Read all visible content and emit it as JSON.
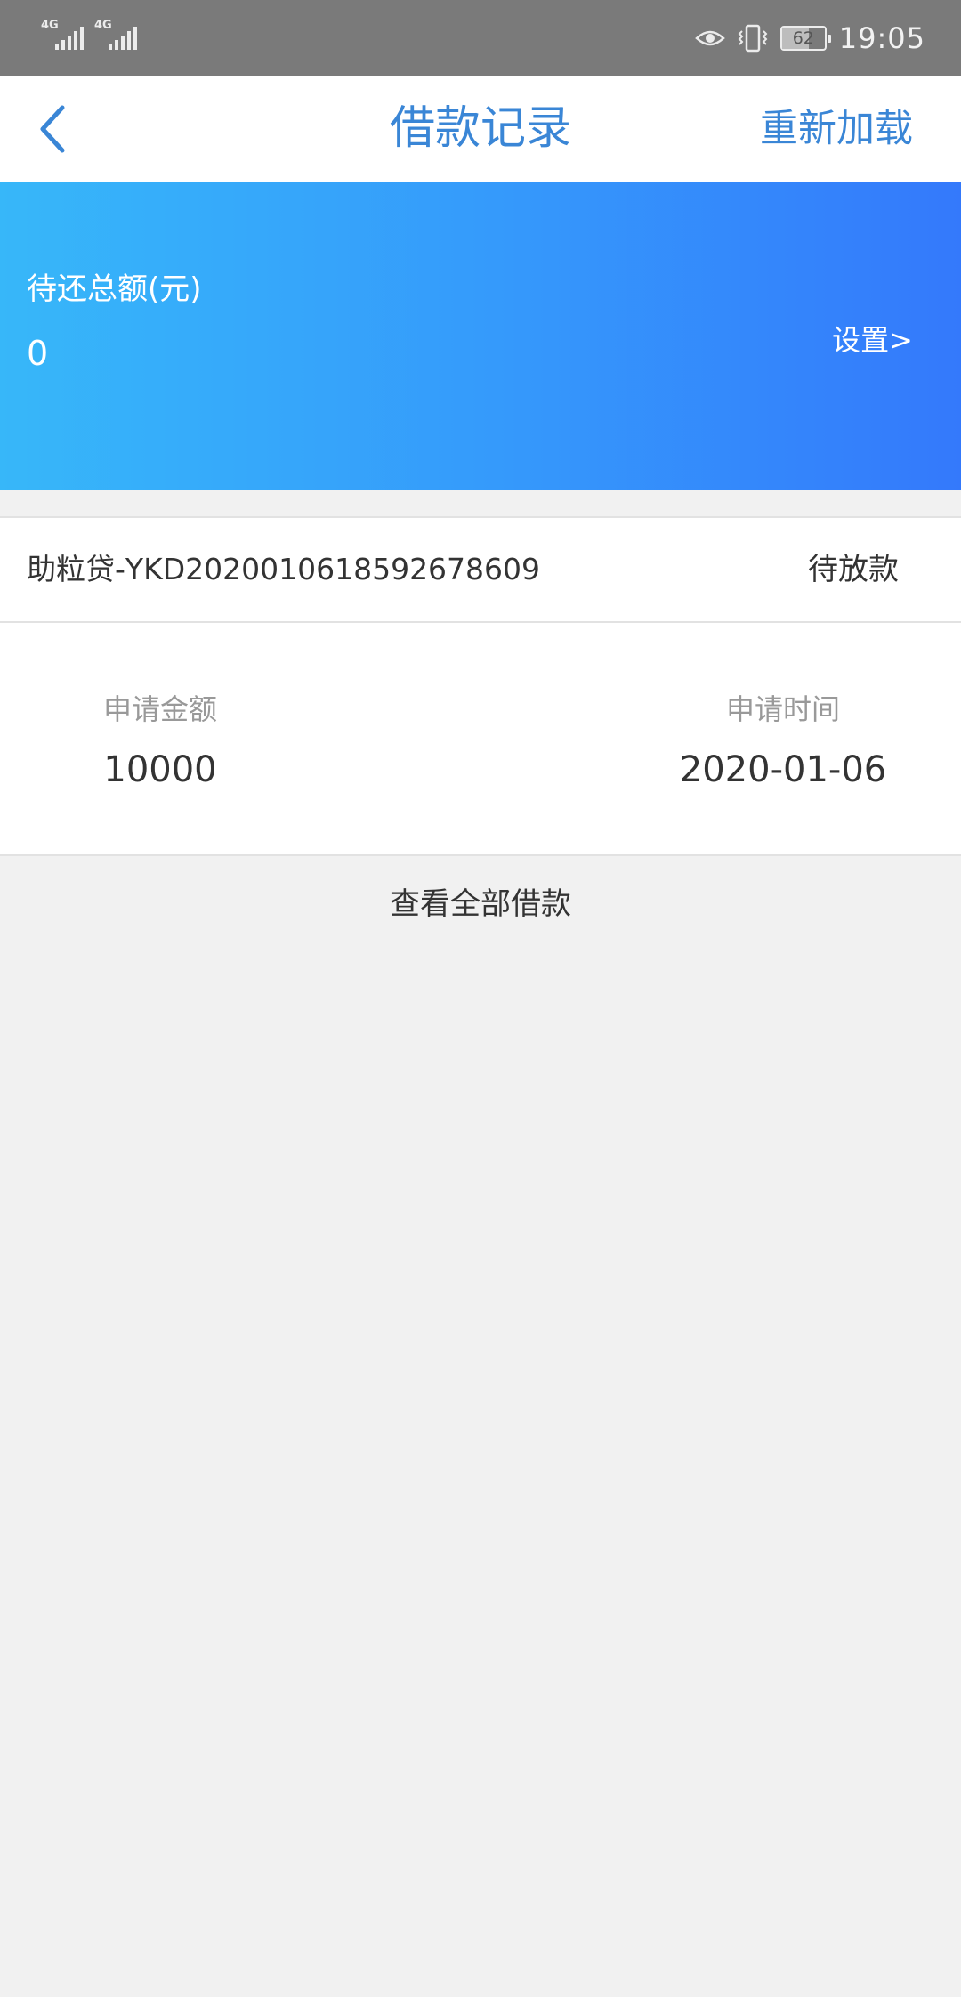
{
  "status_bar": {
    "signal1_tag": "4G",
    "signal2_tag": "4G",
    "battery_level": "62",
    "time": "19:05",
    "icons": [
      "signal-icon",
      "signal-icon",
      "eye-icon",
      "vibrate-icon",
      "battery-icon"
    ]
  },
  "nav": {
    "title": "借款记录",
    "reload_label": "重新加载",
    "back_icon": "chevron-left-icon"
  },
  "banner": {
    "label": "待还总额(元)",
    "amount": "0",
    "settings_link": "设置>"
  },
  "loan": {
    "id": "助粒贷-YKD2020010618592678609",
    "status": "待放款",
    "amount_label": "申请金额",
    "amount_value": "10000",
    "date_label": "申请时间",
    "date_value": "2020-01-06"
  },
  "footer": {
    "view_all": "查看全部借款"
  },
  "colors": {
    "accent": "#3a86d6",
    "banner_start": "#37b7f9",
    "banner_end": "#3479fb",
    "status_bar": "#7a7a7a",
    "page_bg": "#f1f1f1"
  }
}
